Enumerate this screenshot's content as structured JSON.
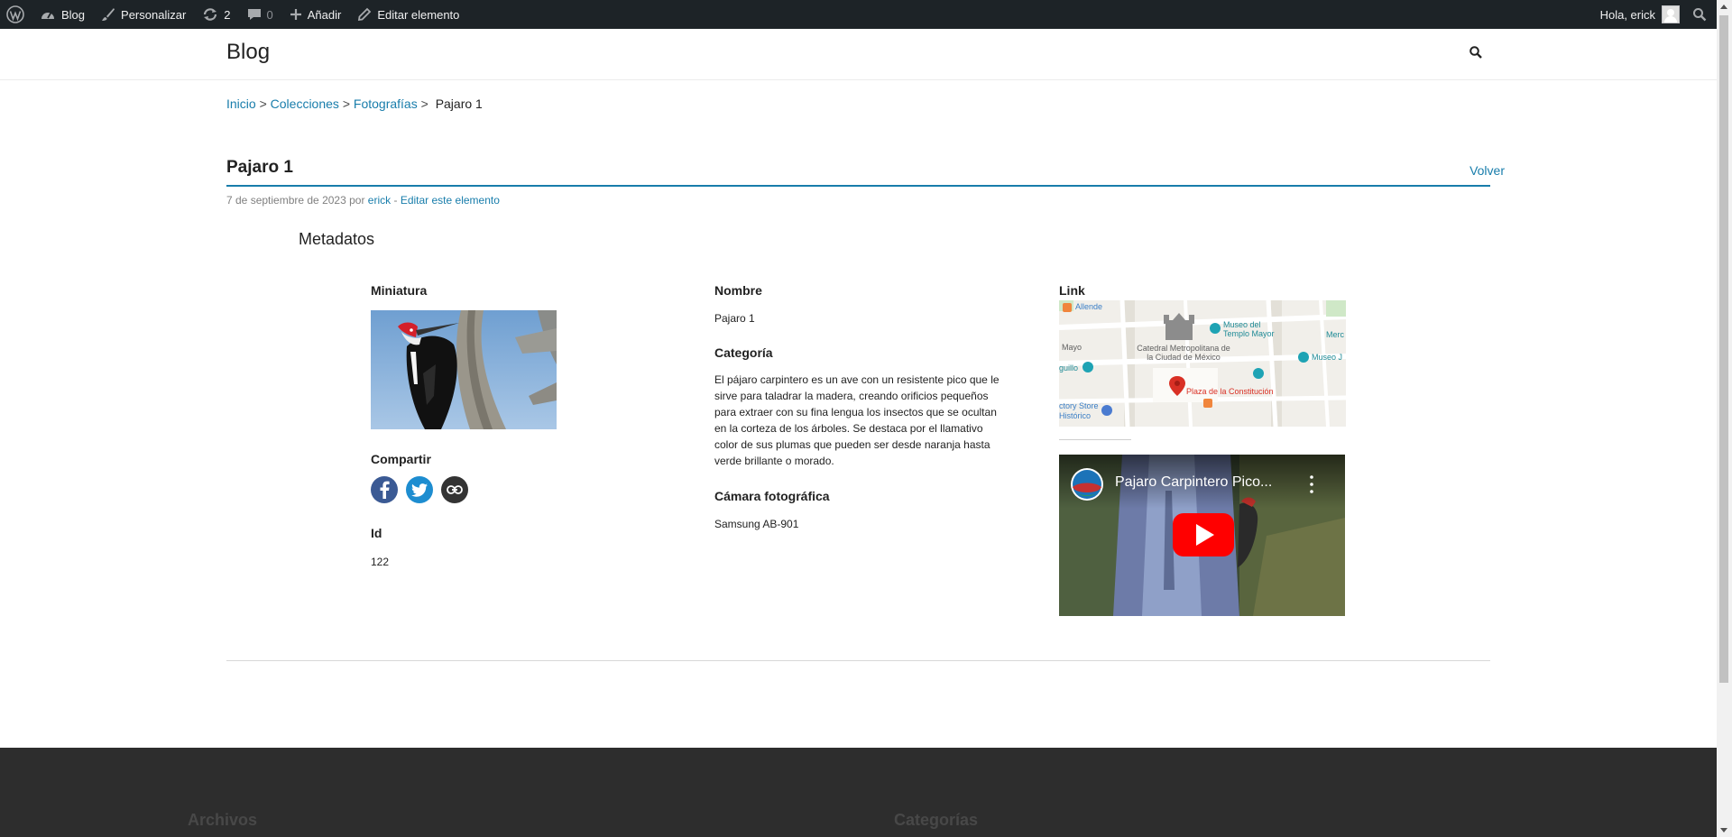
{
  "adminbar": {
    "site_name": "Blog",
    "customize": "Personalizar",
    "updates_count": "2",
    "comments_count": "0",
    "add_new": "Añadir",
    "edit_item": "Editar elemento",
    "greeting": "Hola, erick"
  },
  "header": {
    "site_title": "Blog"
  },
  "breadcrumb": {
    "items": [
      "Inicio",
      "Colecciones",
      "Fotografías"
    ],
    "separator": ">",
    "current": "Pajaro 1"
  },
  "item": {
    "title": "Pajaro 1",
    "back_label": "Volver",
    "date": "7 de septiembre de 2023",
    "by": "por",
    "author": "erick",
    "dash": "-",
    "edit_label": "Editar este elemento"
  },
  "metadata": {
    "heading": "Metadatos",
    "thumbnail_label": "Miniatura",
    "share_label": "Compartir",
    "id_label": "Id",
    "id_value": "122",
    "name_label": "Nombre",
    "name_value": "Pajaro 1",
    "category_label": "Categoría",
    "category_value": "El pájaro carpintero es un ave con un resistente pico que le sirve para taladrar la madera, creando orificios pequeños para extraer con su fina lengua los insectos que se ocultan en la corteza de los árboles. Se destaca por el llamativo color de sus plumas que pueden ser desde naranja hasta verde brillante o morado.",
    "camera_label": "Cámara fotográfica",
    "camera_value": "Samsung AB-901",
    "link_label": "Link"
  },
  "map": {
    "labels": {
      "allende": "Allende",
      "museo_templo": "Museo del Templo Mayor",
      "merc": "Merc",
      "catedral": "Catedral Metropolitana de la Ciudad de México",
      "mayo": "Mayo",
      "museo_j": "Museo J",
      "guillo": "guillo",
      "plaza": "Plaza de la Constitución",
      "store": "ctory Store",
      "historico": "Histórico"
    }
  },
  "video": {
    "title": "Pajaro Carpintero Pico..."
  },
  "footer": {
    "archives": "Archivos",
    "categories": "Categorías"
  },
  "colors": {
    "adminbar": "#1d2327",
    "link": "#187dab",
    "footer": "#2d2d2d"
  }
}
